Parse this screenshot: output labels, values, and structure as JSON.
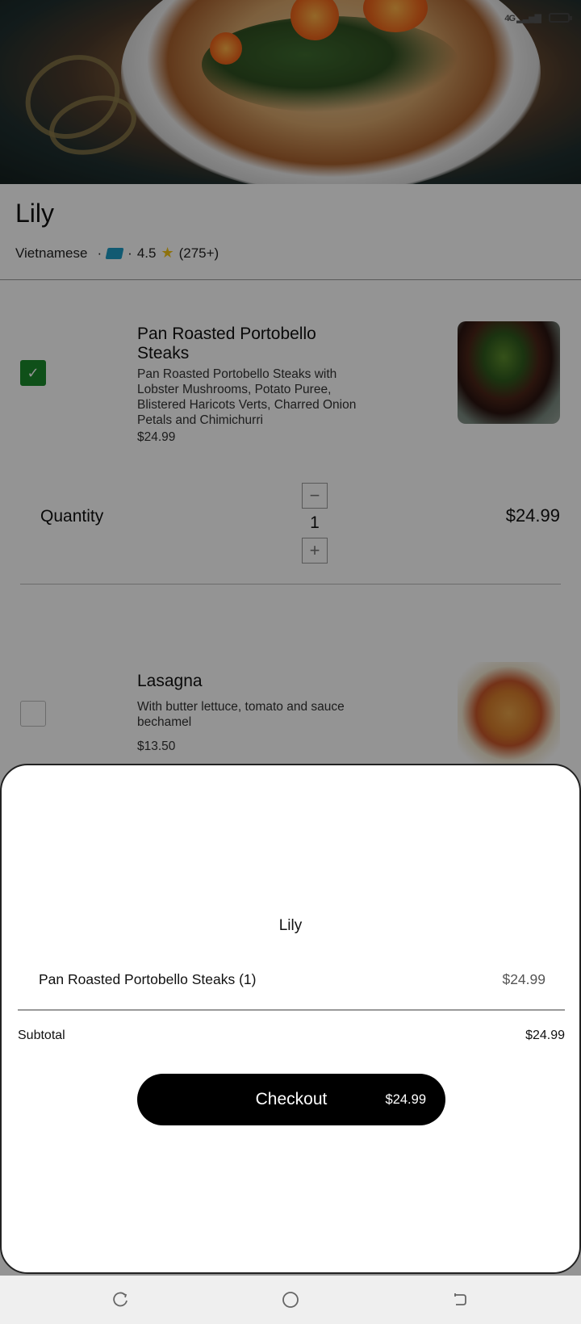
{
  "status_bar": {
    "network": "4G"
  },
  "restaurant": {
    "name": "Lily",
    "cuisine": "Vietnamese",
    "separator": "·",
    "rating": "4.5",
    "reviews": "(275+)"
  },
  "menu": {
    "items": [
      {
        "name": "Pan Roasted Portobello Steaks",
        "description": "Pan Roasted Portobello Steaks with Lobster Mushrooms, Potato Puree, Blistered Haricots Verts, Charred Onion Petals and Chimichurri",
        "price": "$24.99",
        "checked": true
      },
      {
        "name": "Lasagna",
        "description": "With butter lettuce, tomato and sauce bechamel",
        "price": "$13.50",
        "checked": false
      }
    ],
    "quantity": {
      "label": "Quantity",
      "value": "1",
      "total": "$24.99",
      "minus": "−",
      "plus": "+"
    }
  },
  "cart_sheet": {
    "title": "Lily",
    "line_item": {
      "name": "Pan Roasted Portobello Steaks (1)",
      "price": "$24.99"
    },
    "subtotal_label": "Subtotal",
    "subtotal_value": "$24.99",
    "checkout_label": "Checkout",
    "checkout_amount": "$24.99"
  },
  "colors": {
    "accent": "#1a8a2b",
    "button": "#000000",
    "ticket": "#1e9bc4",
    "star": "#f5c518"
  }
}
